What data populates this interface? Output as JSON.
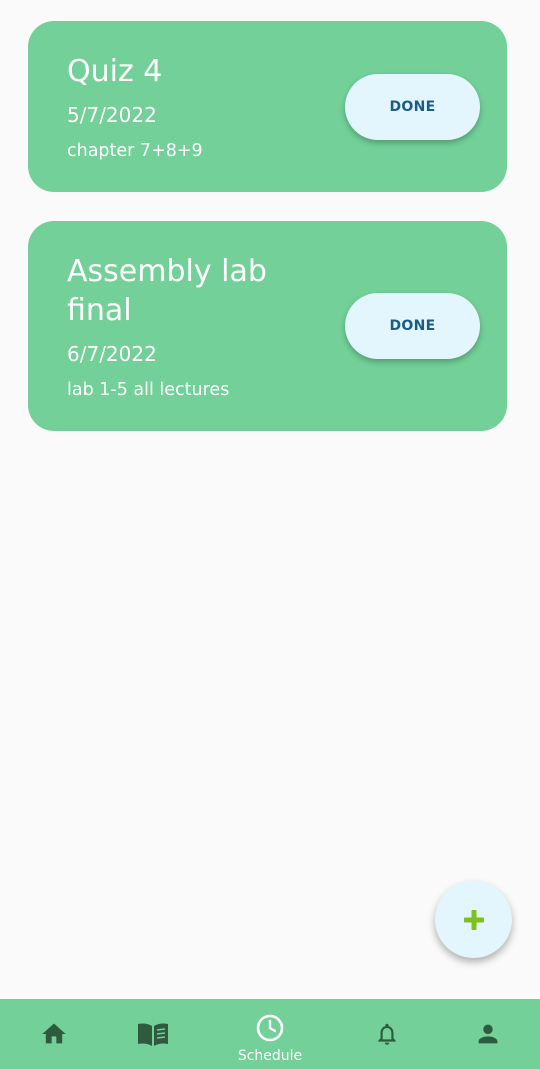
{
  "colors": {
    "card_background": "#72d098",
    "button_background": "#e3f6fd",
    "button_text": "#1a5c8a",
    "fab_plus": "#7cc21c",
    "nav_background": "#72d098",
    "nav_icon_inactive": "#2f5a3e",
    "nav_icon_active": "#ffffff",
    "page_background": "#fafafa"
  },
  "tasks": [
    {
      "title": "Quiz 4",
      "date": "5/7/2022",
      "description": "chapter 7+8+9",
      "done_label": "DONE"
    },
    {
      "title": "Assembly lab final",
      "date": "6/7/2022",
      "description": "lab 1-5 all lectures",
      "done_label": "DONE"
    }
  ],
  "fab": {
    "icon": "plus-icon"
  },
  "bottom_nav": {
    "items": [
      {
        "icon": "home-icon",
        "label": ""
      },
      {
        "icon": "book-icon",
        "label": ""
      },
      {
        "icon": "clock-icon",
        "label": "Schedule",
        "active": true
      },
      {
        "icon": "bell-icon",
        "label": ""
      },
      {
        "icon": "person-icon",
        "label": ""
      }
    ]
  }
}
